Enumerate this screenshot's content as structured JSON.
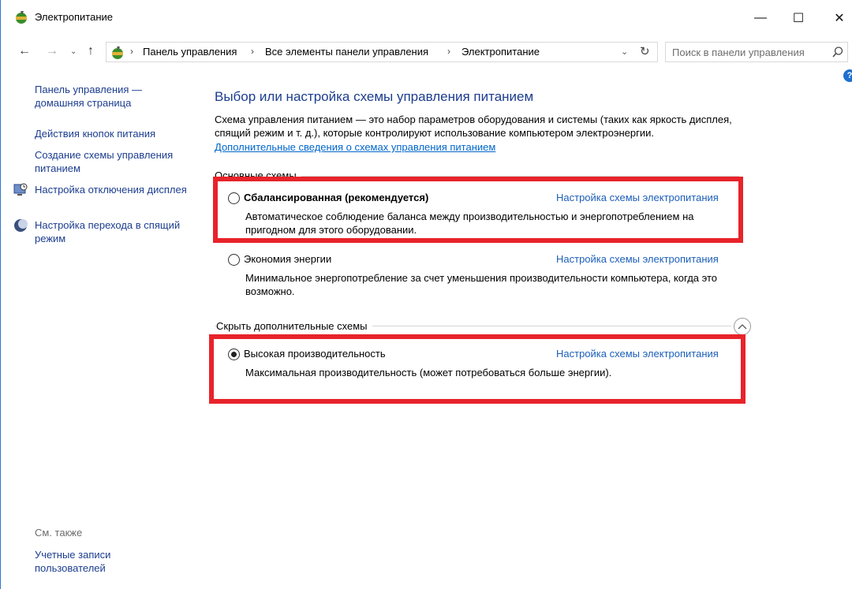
{
  "window": {
    "title": "Электропитание",
    "minimize": "—",
    "maximize": "☐",
    "close": "✕"
  },
  "nav": {
    "back": "←",
    "forward": "→",
    "dropdown": "⌄",
    "up": "↑",
    "breadcrumb": [
      "Панель управления",
      "Все элементы панели управления",
      "Электропитание"
    ],
    "separator": "›",
    "refresh": "↻",
    "search_placeholder": "Поиск в панели управления"
  },
  "sidebar": {
    "home_link": "Панель управления — домашняя страница",
    "items": [
      {
        "label": "Действия кнопок питания",
        "icon": null
      },
      {
        "label": "Создание схемы управления питанием",
        "icon": null
      },
      {
        "label": "Настройка отключения дисплея",
        "icon": "display-icon"
      },
      {
        "label": "Настройка перехода в спящий режим",
        "icon": "moon-icon"
      }
    ],
    "see_also": "См. также",
    "accounts_link": "Учетные записи пользователей"
  },
  "main": {
    "title": "Выбор или настройка схемы управления питанием",
    "description": "Схема управления питанием — это набор параметров оборудования и системы (таких как яркость дисплея, спящий режим и т. д.), которые контролируют использование компьютером электроэнергии.",
    "more_info_link": "Дополнительные сведения о схемах управления питанием",
    "main_group_label": "Основные схемы",
    "extra_group_label": "Скрыть дополнительные схемы",
    "plans": [
      {
        "name": "Сбалансированная (рекомендуется)",
        "selected": false,
        "settings_link": "Настройка схемы электропитания",
        "description": "Автоматическое соблюдение баланса между производительностью и энергопотреблением на пригодном для этого оборудовании."
      },
      {
        "name": "Экономия энергии",
        "selected": false,
        "settings_link": "Настройка схемы электропитания",
        "description": "Минимальное энергопотребление за счет уменьшения производительности компьютера, когда это возможно."
      },
      {
        "name": "Высокая производительность",
        "selected": true,
        "settings_link": "Настройка схемы электропитания",
        "description": "Максимальная производительность (может потребоваться больше энергии)."
      }
    ]
  },
  "colors": {
    "link": "#1c3d8f",
    "highlight": "#e8232a",
    "window_border": "#2b78d0"
  }
}
